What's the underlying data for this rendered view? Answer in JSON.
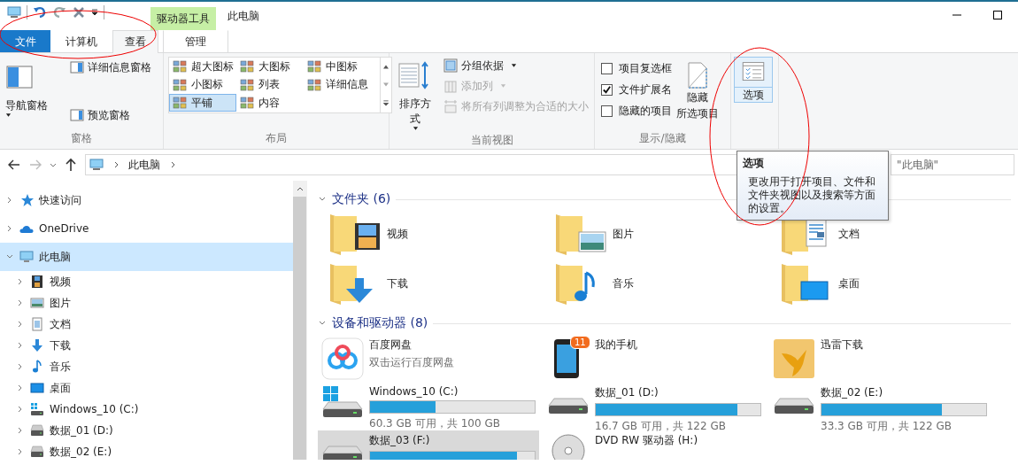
{
  "title_bar": {
    "context_group": "驱动器工具",
    "title": "此电脑"
  },
  "ribbon_tabs": [
    {
      "label": "文件",
      "kind": "file",
      "selected": false
    },
    {
      "label": "计算机",
      "kind": "tab",
      "selected": false
    },
    {
      "label": "查看",
      "kind": "tab",
      "selected": true
    },
    {
      "label": "管理",
      "kind": "context",
      "selected": false
    }
  ],
  "panes_group": {
    "label": "窗格",
    "navigation_pane": "导航窗格",
    "preview_pane": "预览窗格",
    "details_pane": "详细信息窗格"
  },
  "layout_group": {
    "label": "布局",
    "options": [
      {
        "label": "超大图标",
        "selected": false
      },
      {
        "label": "大图标",
        "selected": false
      },
      {
        "label": "中图标",
        "selected": false
      },
      {
        "label": "小图标",
        "selected": false
      },
      {
        "label": "列表",
        "selected": false
      },
      {
        "label": "详细信息",
        "selected": false
      },
      {
        "label": "平铺",
        "selected": true
      },
      {
        "label": "内容",
        "selected": false
      }
    ]
  },
  "current_view_group": {
    "label": "当前视图",
    "sort_by": "排序方式",
    "group_by": "分组依据",
    "add_columns": {
      "label": "添加列",
      "disabled": true
    },
    "size_columns": {
      "label": "将所有列调整为合适的大小",
      "disabled": true
    }
  },
  "show_hide_group": {
    "label": "显示/隐藏",
    "checkboxes": [
      {
        "label": "项目复选框",
        "checked": false
      },
      {
        "label": "文件扩展名",
        "checked": true
      },
      {
        "label": "隐藏的项目",
        "checked": false
      }
    ],
    "hide_selected": [
      "隐藏",
      "所选项目"
    ]
  },
  "options_button": {
    "label": "选项",
    "hovered": true
  },
  "address_bar": {
    "path": [
      "此电脑"
    ]
  },
  "search": {
    "placeholder": "\"此电脑\""
  },
  "nav_tree": [
    {
      "label": "快速访问",
      "kind": "star",
      "expanded": false,
      "selected": false
    },
    {
      "label": "OneDrive",
      "kind": "cloud",
      "expanded": false,
      "selected": false
    },
    {
      "label": "此电脑",
      "kind": "pc",
      "expanded": true,
      "selected": true,
      "children": [
        {
          "label": "视频",
          "kind": "video",
          "expanded": false,
          "selected": false
        },
        {
          "label": "图片",
          "kind": "picture",
          "expanded": false,
          "selected": false
        },
        {
          "label": "文档",
          "kind": "doc",
          "expanded": false,
          "selected": false
        },
        {
          "label": "下载",
          "kind": "download",
          "expanded": false,
          "selected": false
        },
        {
          "label": "音乐",
          "kind": "music",
          "expanded": false,
          "selected": false
        },
        {
          "label": "桌面",
          "kind": "desktop",
          "expanded": false,
          "selected": false
        },
        {
          "label": "Windows_10 (C:)",
          "kind": "system-drive",
          "expanded": false,
          "selected": false
        },
        {
          "label": "数据_01 (D:)",
          "kind": "drive",
          "expanded": false,
          "selected": false
        },
        {
          "label": "数据_02 (E:)",
          "kind": "drive",
          "expanded": false,
          "selected": false
        }
      ]
    }
  ],
  "folders": {
    "title": "文件夹 (6)",
    "items": [
      {
        "name": "视频",
        "kind": "video"
      },
      {
        "name": "图片",
        "kind": "picture"
      },
      {
        "name": "文档",
        "kind": "doc"
      },
      {
        "name": "下载",
        "kind": "download"
      },
      {
        "name": "音乐",
        "kind": "music"
      },
      {
        "name": "桌面",
        "kind": "desktop"
      }
    ]
  },
  "devices": {
    "title": "设备和驱动器 (8)",
    "items": [
      {
        "kind": "cloud-app",
        "name": "百度网盘",
        "subtitle": "双击运行百度网盘",
        "selected": false
      },
      {
        "kind": "phone",
        "name": "我的手机",
        "badge": "11",
        "selected": false
      },
      {
        "kind": "app-folder",
        "name": "迅雷下载",
        "selected": false
      },
      {
        "kind": "system-drive",
        "name": "Windows_10 (C:)",
        "level": 0.4,
        "space": "60.3 GB 可用，共 100 GB",
        "selected": false
      },
      {
        "kind": "drive",
        "name": "数据_01 (D:)",
        "level": 0.86,
        "space": "16.7 GB 可用，共 122 GB",
        "selected": false
      },
      {
        "kind": "drive",
        "name": "数据_02 (E:)",
        "level": 0.73,
        "space": "33.3 GB 可用，共 122 GB",
        "selected": false
      },
      {
        "kind": "drive",
        "name": "数据_03 (F:)",
        "level": 0.89,
        "selected": true
      },
      {
        "kind": "dvd",
        "name": "DVD RW 驱动器 (H:)",
        "selected": false
      }
    ]
  },
  "tooltip": {
    "title": "选项",
    "text": "更改用于打开项目、文件和文件夹视图以及搜索等方面的设置。"
  }
}
